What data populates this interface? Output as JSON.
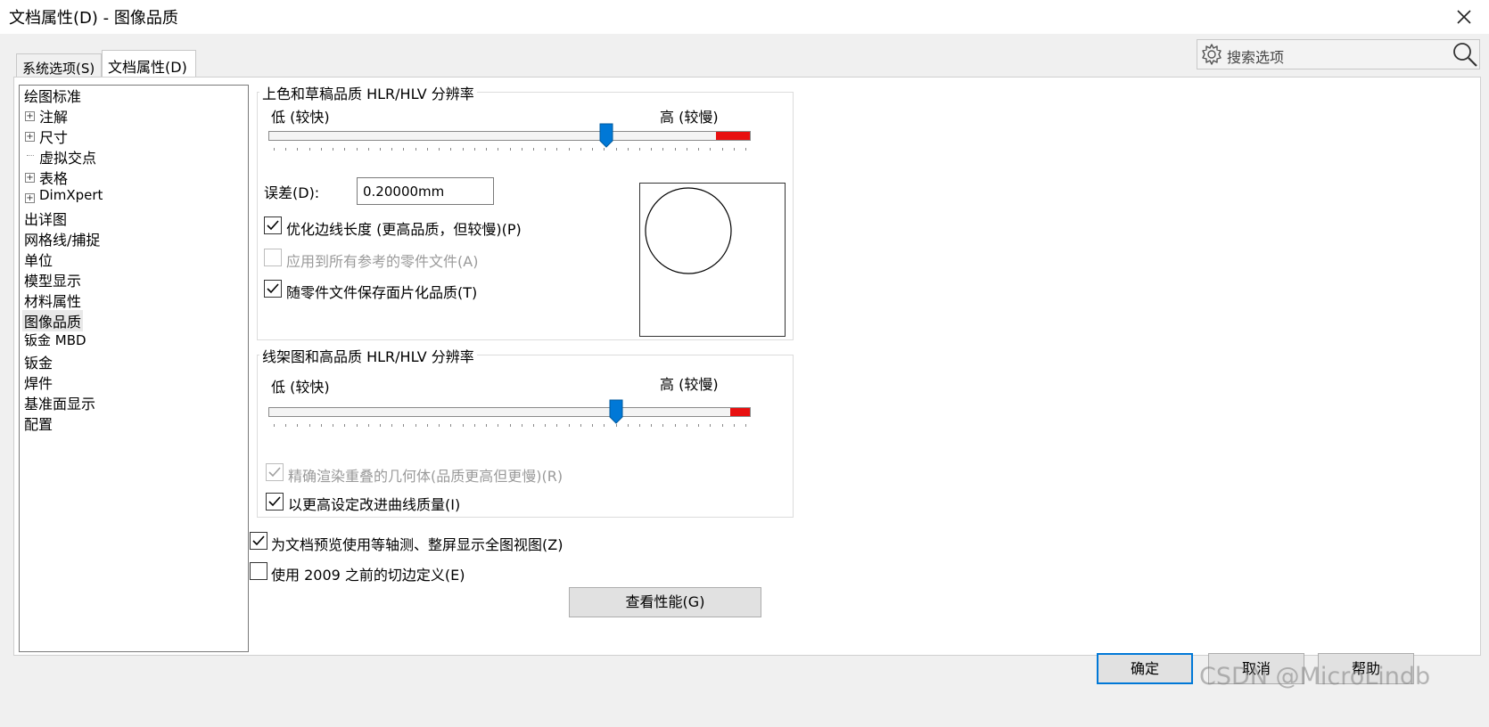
{
  "window": {
    "title": "文档属性(D) - 图像品质",
    "close_glyph": "✕"
  },
  "tabs": [
    {
      "label": "系统选项(S)",
      "active": false
    },
    {
      "label": "文档属性(D)",
      "active": true
    }
  ],
  "search": {
    "placeholder": "搜索选项"
  },
  "tree": {
    "items": [
      {
        "label": "绘图标准",
        "expandable": false
      },
      {
        "label": "注解",
        "expandable": true
      },
      {
        "label": "尺寸",
        "expandable": true
      },
      {
        "label": "虚拟交点",
        "expandable": false
      },
      {
        "label": "表格",
        "expandable": true
      },
      {
        "label": "DimXpert",
        "expandable": true
      },
      {
        "label": "出详图",
        "expandable": false
      },
      {
        "label": "网格线/捕捉",
        "expandable": false
      },
      {
        "label": "单位",
        "expandable": false
      },
      {
        "label": "模型显示",
        "expandable": false
      },
      {
        "label": "材料属性",
        "expandable": false
      },
      {
        "label": "图像品质",
        "expandable": false,
        "selected": true
      },
      {
        "label": "钣金 MBD",
        "expandable": false
      },
      {
        "label": "钣金",
        "expandable": false
      },
      {
        "label": "焊件",
        "expandable": false
      },
      {
        "label": "基准面显示",
        "expandable": false
      },
      {
        "label": "配置",
        "expandable": false
      }
    ]
  },
  "shaded_group": {
    "title": "上色和草稿品质 HLR/HLV 分辨率",
    "low_label": "低 (较快)",
    "high_label": "高 (较慢)",
    "slider_value_fraction": 0.7,
    "tolerance_label": "误差(D):",
    "tolerance_value": "0.20000mm",
    "optimize_edge_label": "优化边线长度 (更高品质，但较慢)(P)",
    "optimize_edge_checked": true,
    "apply_all_label": "应用到所有参考的零件文件(A)",
    "apply_all_checked": false,
    "save_tess_label": "随零件文件保存面片化品质(T)",
    "save_tess_checked": true
  },
  "wireframe_group": {
    "title": "线架图和高品质 HLR/HLV 分辨率",
    "low_label": "低 (较快)",
    "high_label": "高 (较慢)",
    "slider_value_fraction": 0.72,
    "precise_render_label": "精确渲染重叠的几何体(品质更高但更慢)(R)",
    "precise_render_checked": true,
    "improve_curve_label": "以更高设定改进曲线质量(I)",
    "improve_curve_checked": true
  },
  "preview_iso_label": "为文档预览使用等轴测、整屏显示全图视图(Z)",
  "preview_iso_checked": true,
  "pre2009_label": "使用 2009 之前的切边定义(E)",
  "pre2009_checked": false,
  "perf_button": "查看性能(G)",
  "buttons": {
    "ok": "确定",
    "cancel": "取消",
    "help": "帮助"
  },
  "watermark": "CSDN @MicroLindb",
  "colors": {
    "accent": "#0078d7",
    "slider_red": "#e81010"
  }
}
